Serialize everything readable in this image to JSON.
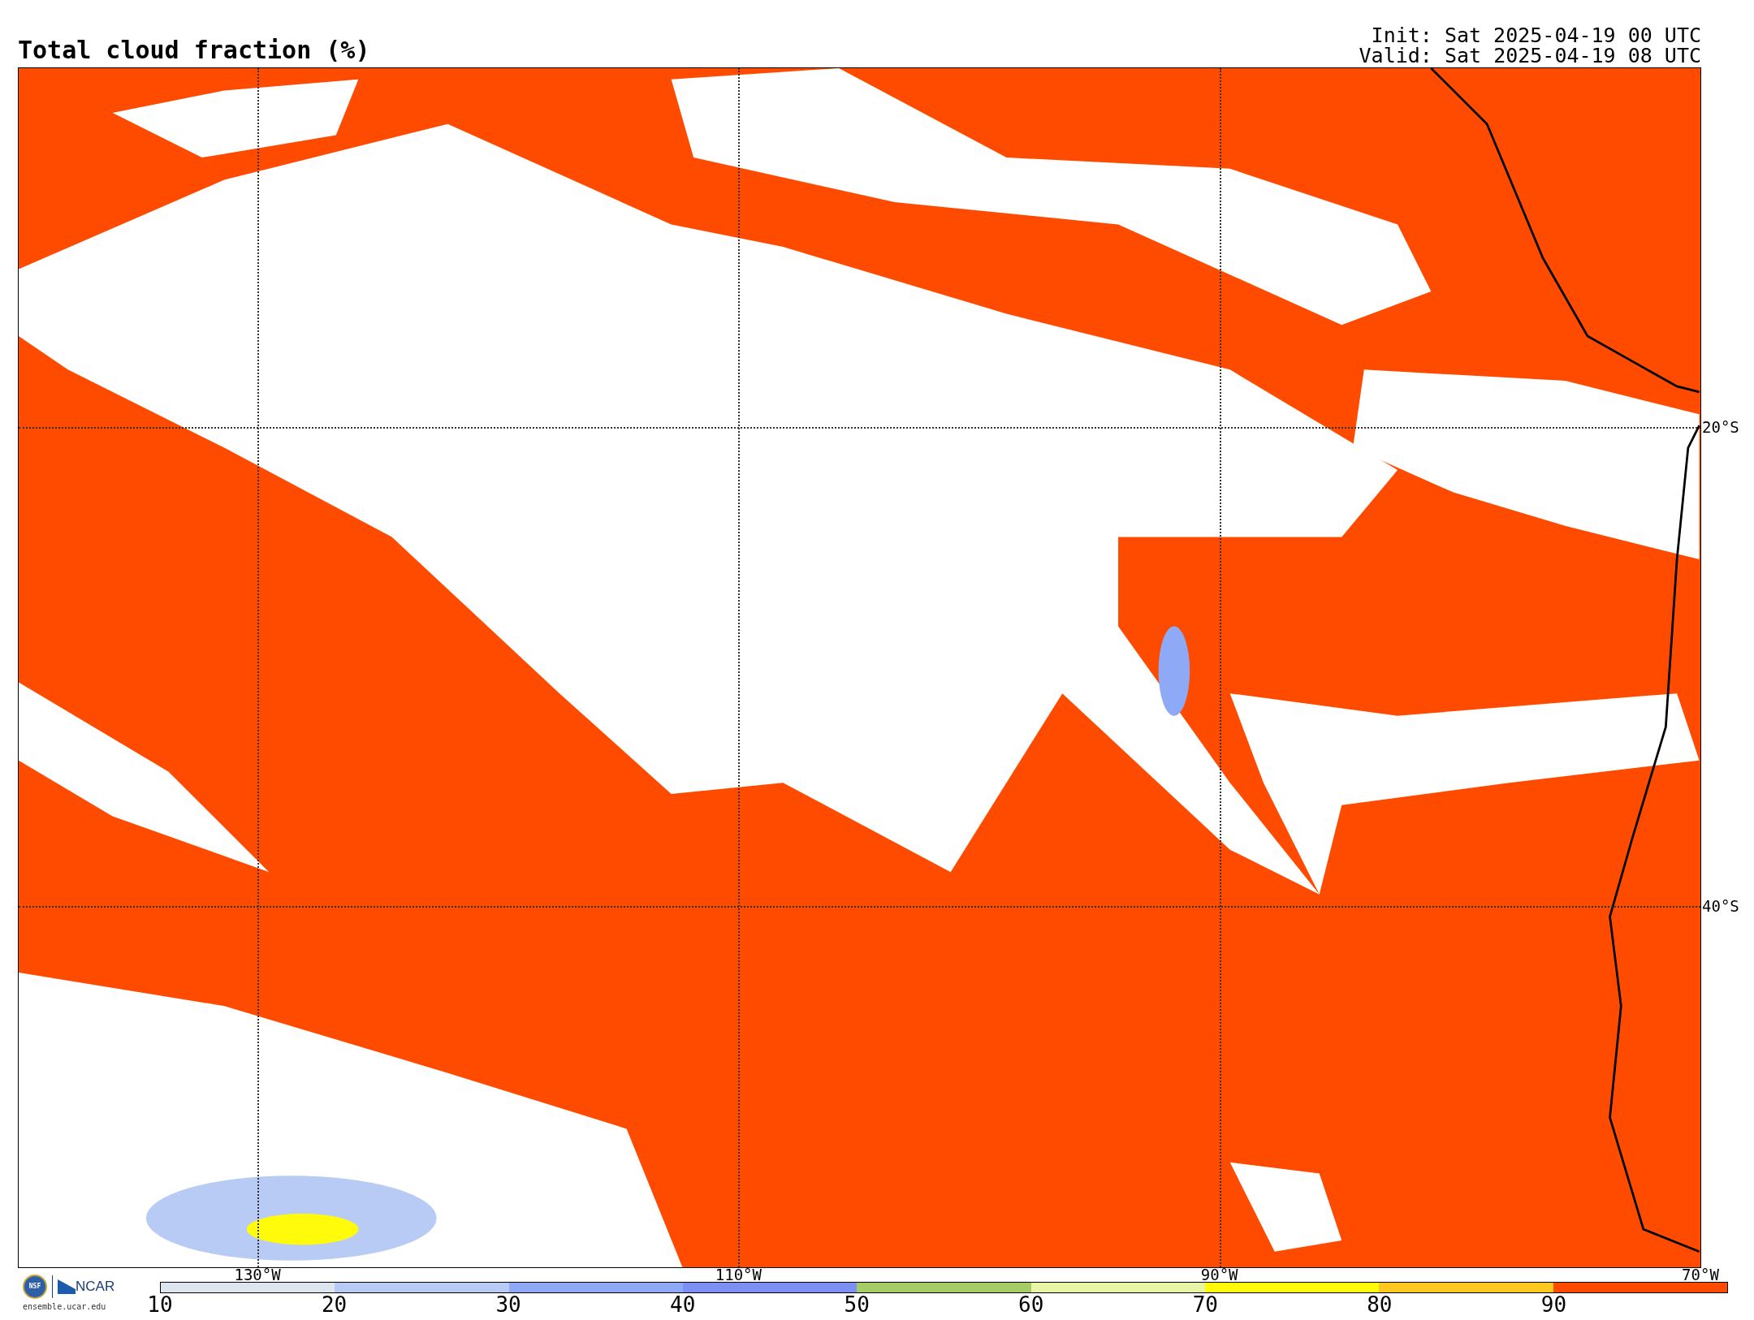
{
  "title": "Total cloud fraction (%)",
  "init": "Init: Sat 2025-04-19 00 UTC",
  "valid": "Valid: Sat 2025-04-19 08 UTC",
  "map": {
    "lat_labels": [
      "20°S",
      "40°S"
    ],
    "lon_labels": [
      "130°W",
      "110°W",
      "90°W",
      "70°W"
    ]
  },
  "logo": {
    "seal": "NSF",
    "name": "NCAR",
    "url": "ensemble.ucar.edu"
  },
  "colorbar": {
    "bins": [
      {
        "color": "#dde6ee"
      },
      {
        "color": "#b7cbf5"
      },
      {
        "color": "#8eaaf6"
      },
      {
        "color": "#7d8ff5"
      },
      {
        "color": "#a6cc65"
      },
      {
        "color": "#e8f5a5"
      },
      {
        "color": "#fffb0a"
      },
      {
        "color": "#fdc920"
      },
      {
        "color": "#ff4b00"
      }
    ],
    "ticks": [
      "10",
      "20",
      "30",
      "40",
      "50",
      "60",
      "70",
      "80",
      "90"
    ]
  }
}
